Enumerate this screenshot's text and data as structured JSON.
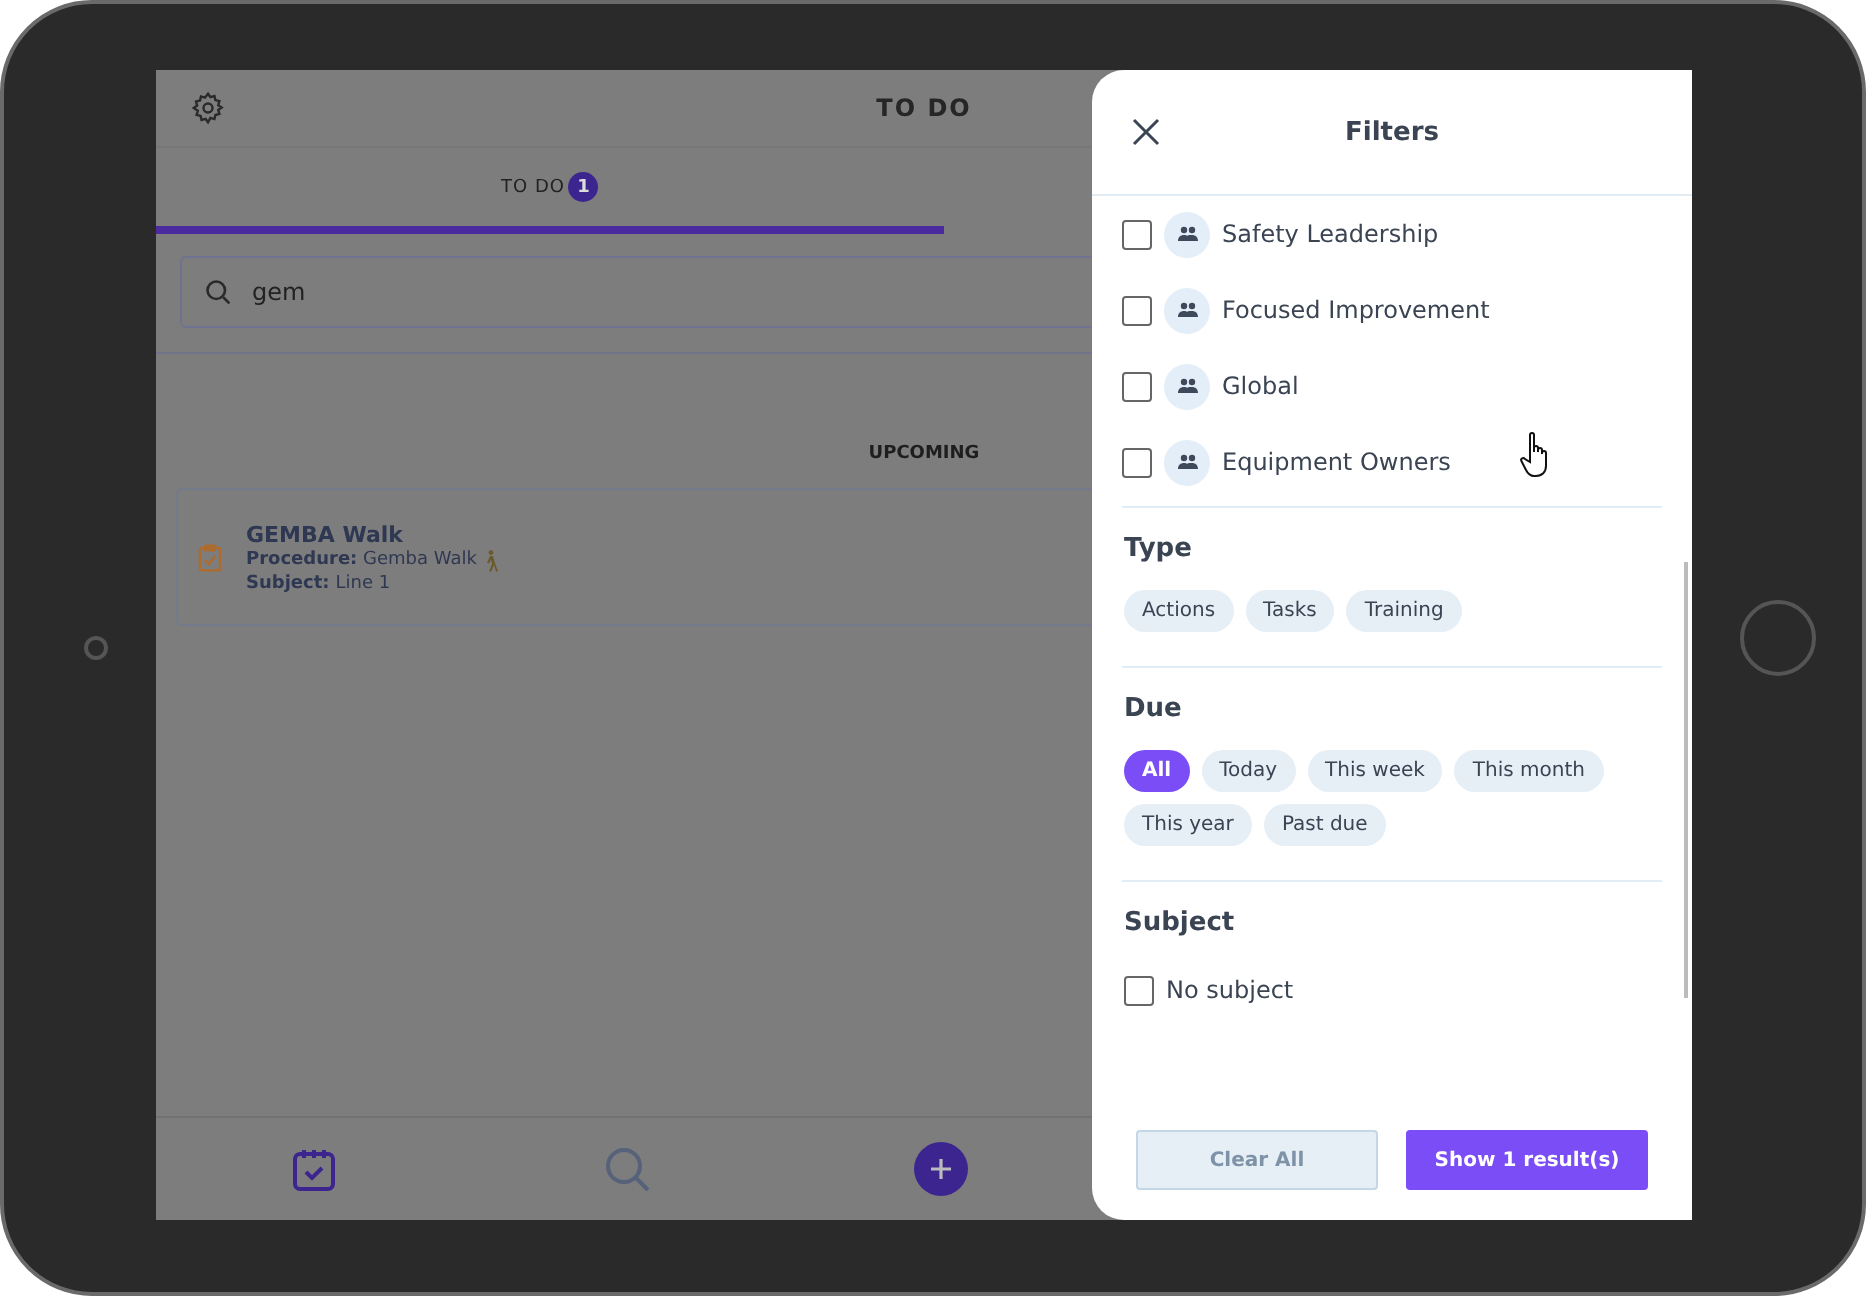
{
  "app": {
    "title": "TO DO",
    "tabs": [
      {
        "label": "TO DO",
        "badge": "1",
        "selected": true
      }
    ],
    "search": {
      "value": "gem"
    },
    "section": "UPCOMING",
    "items": [
      {
        "title": "GEMBA Walk",
        "procedure_label": "Procedure:",
        "procedure": "Gemba Walk",
        "subject_label": "Subject:",
        "subject": "Line 1"
      }
    ],
    "nav": [
      {
        "kind": "calendar",
        "selected": true
      },
      {
        "kind": "search",
        "selected": false
      },
      {
        "kind": "add",
        "selected": false
      }
    ]
  },
  "filters": {
    "title": "Filters",
    "groups": [
      {
        "name": "Safety Leadership",
        "checked": false
      },
      {
        "name": "Focused Improvement",
        "checked": false
      },
      {
        "name": "Global",
        "checked": false
      },
      {
        "name": "Equipment Owners",
        "checked": false
      }
    ],
    "type": {
      "heading": "Type",
      "chips": [
        {
          "label": "Actions",
          "selected": false
        },
        {
          "label": "Tasks",
          "selected": false
        },
        {
          "label": "Training",
          "selected": false
        }
      ]
    },
    "due": {
      "heading": "Due",
      "chips": [
        {
          "label": "All",
          "selected": true
        },
        {
          "label": "Today",
          "selected": false
        },
        {
          "label": "This week",
          "selected": false
        },
        {
          "label": "This month",
          "selected": false
        },
        {
          "label": "This year",
          "selected": false
        },
        {
          "label": "Past due",
          "selected": false
        }
      ]
    },
    "subject": {
      "heading": "Subject",
      "options": [
        {
          "label": "No subject",
          "checked": false
        }
      ]
    },
    "clear": {
      "label": "Clear All",
      "disabled": true
    },
    "show": {
      "label": "Show 1 result(s)"
    }
  }
}
